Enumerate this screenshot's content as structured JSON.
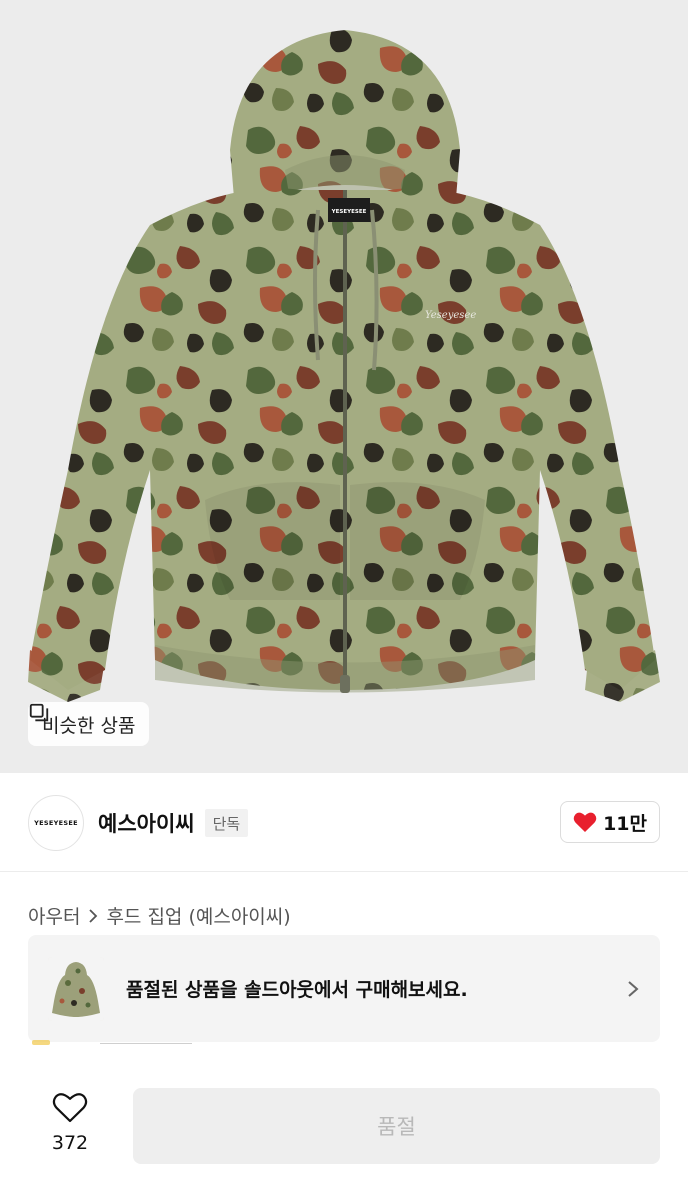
{
  "hero": {
    "product_tag_text": "YESEYESEE",
    "similar_label": "비슷한 상품",
    "similar_icon": "copy-icon"
  },
  "brand": {
    "logo_text": "YESEYESEE",
    "name": "예스아이씨",
    "exclusive_badge": "단독",
    "like_count": "11만",
    "like_icon": "heart-filled-icon",
    "like_color": "#e8202e"
  },
  "breadcrumb": {
    "category": "아우터",
    "subcategory": "후드 집업 (예스아이씨)"
  },
  "soldout_banner": {
    "text": "품절된 상품을 솔드아웃에서 구매해보세요."
  },
  "bottom_bar": {
    "wish_count": "372",
    "buy_label": "품절"
  },
  "colors": {
    "camo_base": "#a4ac82",
    "camo_green": "#53683d",
    "camo_brown": "#7a3e2c",
    "camo_rust": "#a8583c",
    "camo_dark": "#2d2a22",
    "accent_red": "#e8202e"
  }
}
